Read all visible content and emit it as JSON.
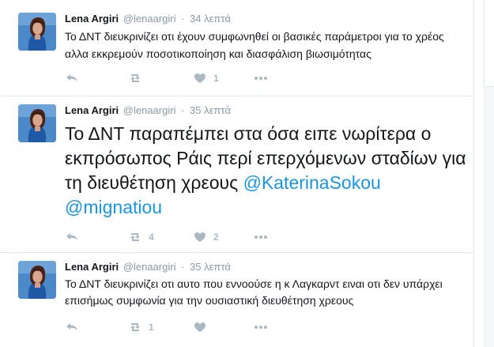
{
  "tweets": [
    {
      "name": "Lena Argiri",
      "handle": "@lenaargiri",
      "separator": "·",
      "time": "34 λεπτά",
      "text_parts": [
        "Το ΔΝΤ διευκρινίζει οτι έχουν συμφωνηθεί οι βασικές παράμετροι για το χρέος αλλα εκκρεμούν ποσοτικοποίηση και διασφάλιση βιωσιμότητας"
      ],
      "retweets": "",
      "likes": "1"
    },
    {
      "name": "Lena Argiri",
      "handle": "@lenaargiri",
      "separator": "·",
      "time": "35 λεπτά",
      "text_parts": [
        "Το ΔΝΤ παραπέμπει στα όσα ειπε νωρίτερα ο εκπρόσωπος Ράις περί επερχόμενων σταδίων  για τη διευθέτηση χρεους ",
        "@KaterinaSokou",
        " ",
        "@mignatiou"
      ],
      "retweets": "4",
      "likes": "2"
    },
    {
      "name": "Lena Argiri",
      "handle": "@lenaargiri",
      "separator": "·",
      "time": "35 λεπτά",
      "text_parts": [
        "Το ΔΝΤ διευκρινίζει οτι αυτο που εννοούσε η κ Λαγκαρντ ειναι οτι δεν υπάρχει επισήμως συμφωνία για την ουσιαστική διευθέτηση χρεους"
      ],
      "retweets": "1",
      "likes": ""
    }
  ],
  "icons": {
    "reply": "reply-icon",
    "retweet": "retweet-icon",
    "like": "heart-icon",
    "more": "more-icon",
    "avatar": "avatar"
  },
  "colors": {
    "text": "#14171a",
    "meta": "#8899a6",
    "mention": "#1b95e0",
    "action": "#aab8c2",
    "divider": "#e1e8ed"
  }
}
